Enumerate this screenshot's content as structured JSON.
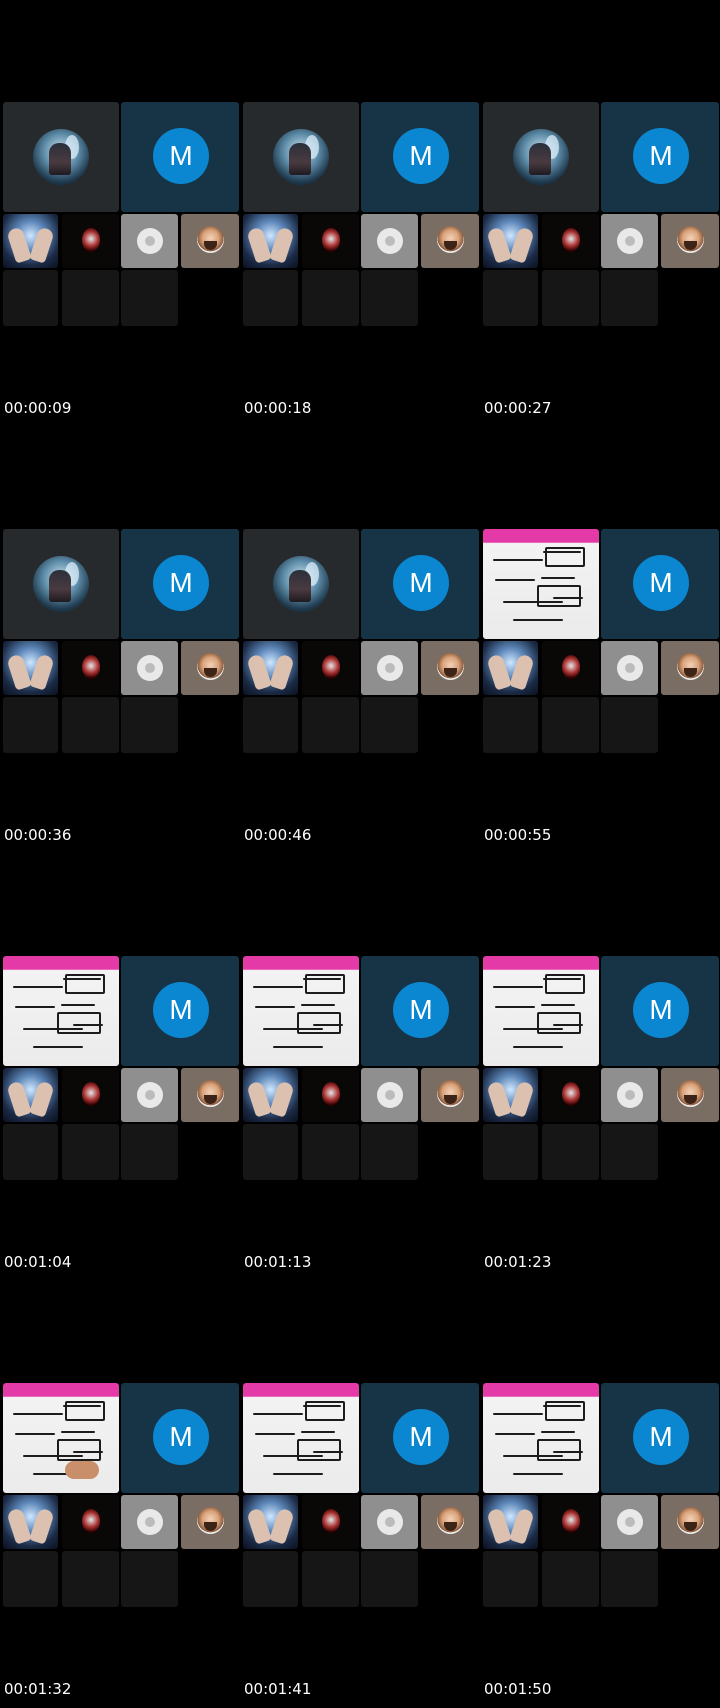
{
  "frames": [
    {
      "timestamp": "00:00:09",
      "main_view": "avatar",
      "avatar_letter": "M"
    },
    {
      "timestamp": "00:00:18",
      "main_view": "avatar",
      "avatar_letter": "M"
    },
    {
      "timestamp": "00:00:27",
      "main_view": "avatar",
      "avatar_letter": "M"
    },
    {
      "timestamp": "00:00:36",
      "main_view": "avatar",
      "avatar_letter": "M"
    },
    {
      "timestamp": "00:00:46",
      "main_view": "avatar",
      "avatar_letter": "M"
    },
    {
      "timestamp": "00:00:55",
      "main_view": "whiteboard",
      "avatar_letter": "M"
    },
    {
      "timestamp": "00:01:04",
      "main_view": "whiteboard",
      "avatar_letter": "M"
    },
    {
      "timestamp": "00:01:13",
      "main_view": "whiteboard",
      "avatar_letter": "M"
    },
    {
      "timestamp": "00:01:23",
      "main_view": "whiteboard",
      "avatar_letter": "M"
    },
    {
      "timestamp": "00:01:32",
      "main_view": "whiteboard",
      "avatar_letter": "M"
    },
    {
      "timestamp": "00:01:41",
      "main_view": "whiteboard",
      "avatar_letter": "M"
    },
    {
      "timestamp": "00:01:50",
      "main_view": "whiteboard",
      "avatar_letter": "M"
    }
  ],
  "colors": {
    "background": "#000000",
    "avatar_blue": "#0a87d0",
    "participant_tile": "#173447",
    "empty_tile": "#161616",
    "whiteboard_banner": "#e43aa8"
  },
  "icons": [
    "user-placeholder-icon",
    "avatar-m-icon"
  ]
}
